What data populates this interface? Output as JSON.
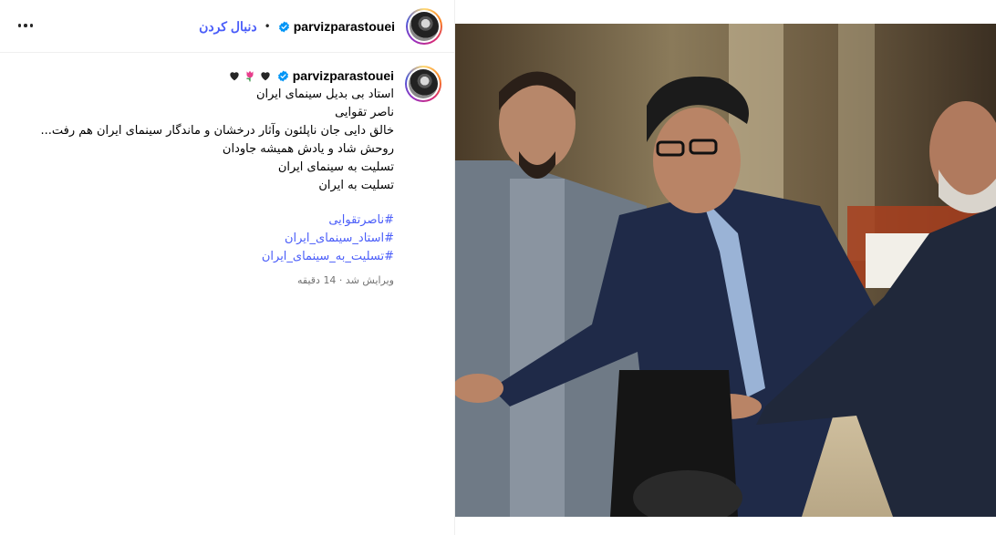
{
  "header": {
    "username": "parvizparastouei",
    "separator": "•",
    "follow_label": "دنبال کردن",
    "more_icon": "more-horizontal-icon"
  },
  "caption": {
    "username": "parvizparastouei",
    "lines": [
      "استاد بی بدیل سینمای ایران",
      "ناصر تقوایی",
      "خالق دایی جان ناپلئون وآثار درخشان و ماندگار سینمای ایران هم رفت...",
      "روحش شاد و یادش همیشه جاودان",
      "تسلیت به سینمای ایران",
      "تسلیت به ایران"
    ],
    "hashtags": [
      "#ناصرتقوایی",
      "#استاد_سینمای_ایران",
      "#تسلیت_به_سینمای_ایران"
    ],
    "meta": "ویرایش شد · 14 دقیقه"
  },
  "colors": {
    "accent": "#4a5df9",
    "verified": "#0095f6",
    "muted": "#737373",
    "heart_black": "#262626",
    "flower_pink": "#e83e8c"
  }
}
